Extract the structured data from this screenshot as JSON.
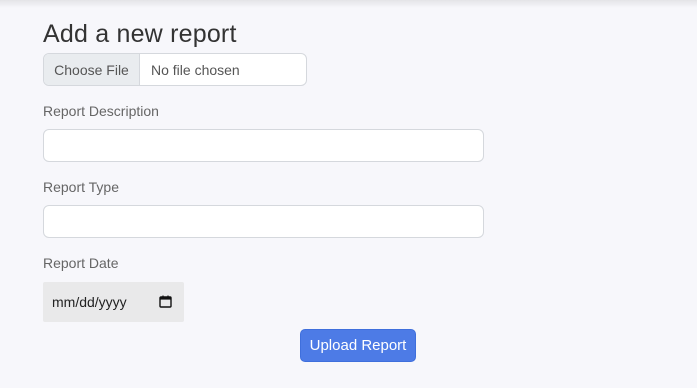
{
  "form": {
    "title": "Add a new report",
    "file": {
      "button_label": "Choose File",
      "status": "No file chosen"
    },
    "description": {
      "label": "Report Description",
      "value": ""
    },
    "type": {
      "label": "Report Type",
      "value": ""
    },
    "date": {
      "label": "Report Date",
      "placeholder": "mm/dd/yyyy",
      "icon": "calendar-icon"
    },
    "submit_label": "Upload Report"
  },
  "colors": {
    "background": "#f7f7fb",
    "primary_button": "#4d7be6",
    "date_field_bg": "#e9e9ea"
  }
}
